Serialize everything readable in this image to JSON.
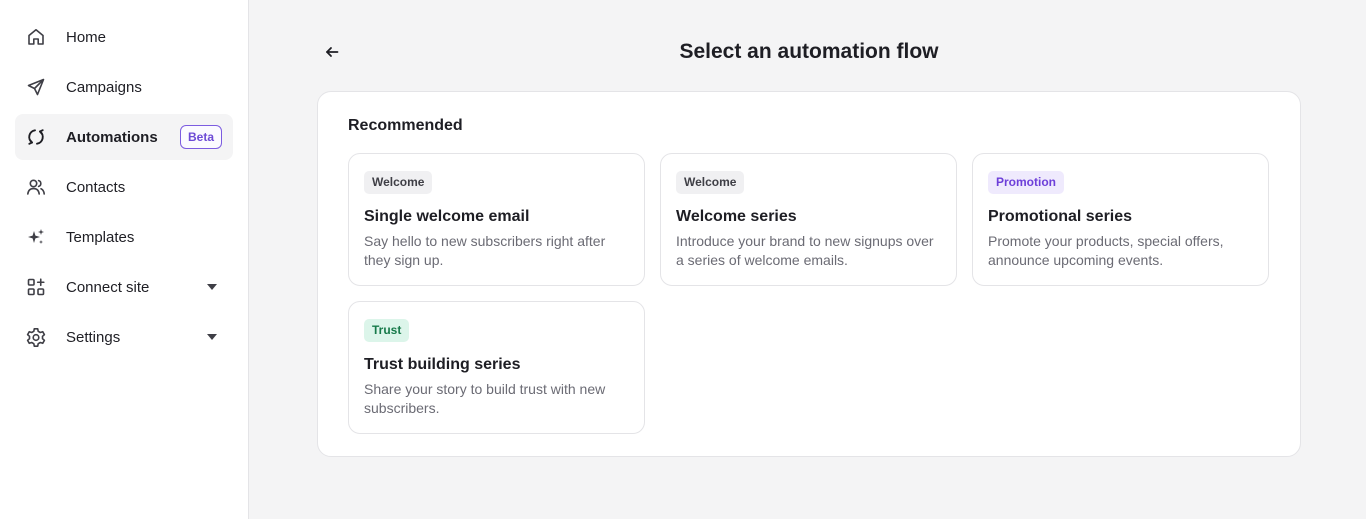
{
  "sidebar": {
    "items": [
      {
        "label": "Home",
        "icon": "home-icon"
      },
      {
        "label": "Campaigns",
        "icon": "send-icon"
      },
      {
        "label": "Automations",
        "icon": "sync-icon",
        "badge": "Beta",
        "active": true
      },
      {
        "label": "Contacts",
        "icon": "users-icon"
      },
      {
        "label": "Templates",
        "icon": "sparkles-icon"
      },
      {
        "label": "Connect site",
        "icon": "apps-add-icon",
        "expandable": true
      },
      {
        "label": "Settings",
        "icon": "gear-icon",
        "expandable": true
      }
    ]
  },
  "header": {
    "title": "Select an automation flow"
  },
  "section": {
    "title": "Recommended"
  },
  "cards": [
    {
      "tag": "Welcome",
      "tag_style": "welcome",
      "title": "Single welcome email",
      "description": "Say hello to new subscribers right after they sign up."
    },
    {
      "tag": "Welcome",
      "tag_style": "welcome",
      "title": "Welcome series",
      "description": "Introduce your brand to new signups over a series of welcome emails."
    },
    {
      "tag": "Promotion",
      "tag_style": "promotion",
      "title": "Promotional series",
      "description": "Promote your products, special offers, announce upcoming events."
    },
    {
      "tag": "Trust",
      "tag_style": "trust",
      "title": "Trust building series",
      "description": "Share your story to build trust with new subscribers."
    }
  ],
  "colors": {
    "accent": "#6d4ad6",
    "background": "#f4f4f5",
    "welcome_tag": "#f0f0f2",
    "promotion_tag": "#efeafd",
    "trust_tag": "#dcf5ea"
  }
}
